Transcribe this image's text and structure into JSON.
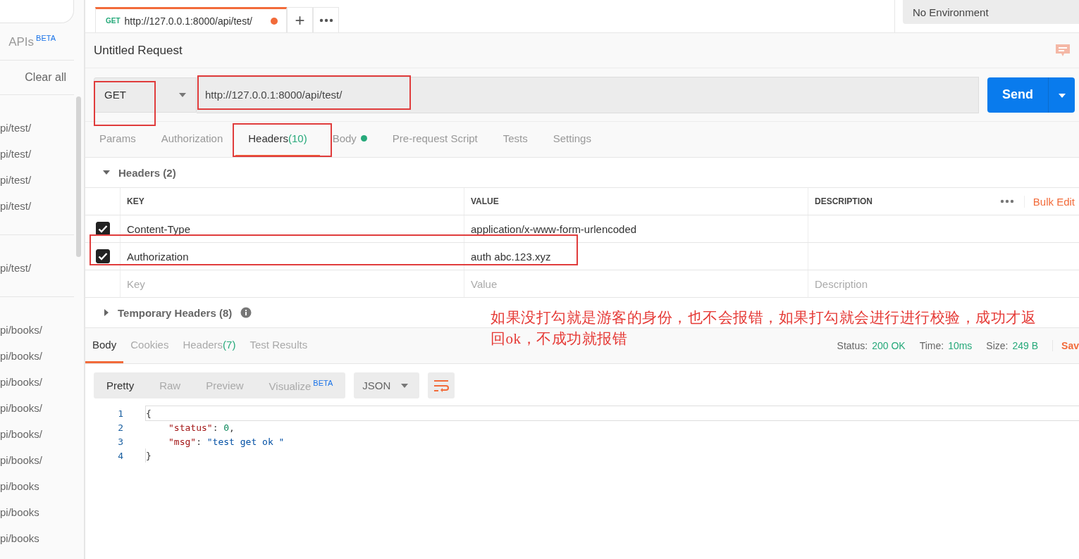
{
  "sidebar": {
    "apis_label": "APIs",
    "apis_badge": "BETA",
    "clear_all": "Clear all",
    "history_groups": [
      [
        "pi/test/",
        "pi/test/",
        "pi/test/",
        "pi/test/"
      ],
      [
        "pi/test/"
      ],
      [
        "pi/books/",
        "pi/books/",
        "pi/books/",
        "pi/books/",
        "pi/books/",
        "pi/books/",
        "pi/books",
        "pi/books",
        "pi/books"
      ]
    ]
  },
  "open_tab": {
    "method": "GET",
    "url": "http://127.0.0.1:8000/api/test/",
    "unsaved": true,
    "selected": true
  },
  "new_tab": "+",
  "environment": "No Environment",
  "request": {
    "title": "Untitled Request",
    "method": "GET",
    "url": "http://127.0.0.1:8000/api/test/",
    "send": "Send"
  },
  "request_tabs": [
    {
      "label": "Params",
      "selected": false
    },
    {
      "label": "Authorization",
      "selected": false
    },
    {
      "label": "Headers",
      "count": "(10)",
      "selected": true
    },
    {
      "label": "Body",
      "dot": true,
      "selected": false
    },
    {
      "label": "Pre-request Script",
      "selected": false
    },
    {
      "label": "Tests",
      "selected": false
    },
    {
      "label": "Settings",
      "selected": false
    }
  ],
  "headers_section": {
    "title": "Headers",
    "count": "(2)",
    "expanded": true
  },
  "columns": [
    "KEY",
    "VALUE",
    "DESCRIPTION"
  ],
  "bulk_edit": "Bulk Edit",
  "header_rows": [
    {
      "key": "Content-Type",
      "value": "application/x-www-form-urlencoded",
      "checked": true
    },
    {
      "key": "Authorization",
      "value": "auth abc.123.xyz",
      "checked": true
    }
  ],
  "new_row": {
    "key_placeholder": "Key",
    "value_placeholder": "Value",
    "description_placeholder": "Description"
  },
  "temporary_headers": {
    "title": "Temporary Headers",
    "count": "(8)",
    "expanded": false
  },
  "annotation_lines": [
    "如果没打勾就是游客的身份，也不会报错，如果打勾就会进行进行校验，成功才返",
    "回ok，不成功就报错"
  ],
  "response_tabs": [
    {
      "label": "Body",
      "selected": true
    },
    {
      "label": "Cookies",
      "selected": false
    },
    {
      "label": "Headers",
      "count": "(7)",
      "selected": false
    },
    {
      "label": "Test Results",
      "selected": false
    }
  ],
  "response_meta": [
    {
      "label": "Status:",
      "value": "200 OK"
    },
    {
      "label": "Time:",
      "value": "10ms"
    },
    {
      "label": "Size:",
      "value": "249 B"
    }
  ],
  "save": "Sav",
  "view_modes": [
    {
      "label": "Pretty",
      "selected": true
    },
    {
      "label": "Raw",
      "selected": false
    },
    {
      "label": "Preview",
      "selected": false
    },
    {
      "label": "Visualize",
      "badge": "BETA",
      "selected": false
    }
  ],
  "format": "JSON",
  "code_lines": [
    {
      "number": "1",
      "indent": false,
      "tokens": [
        {
          "kind": "punct",
          "text": "{"
        }
      ]
    },
    {
      "number": "2",
      "indent": true,
      "tokens": [
        {
          "kind": "key",
          "text": "\"status\""
        },
        {
          "kind": "punct",
          "text": ": "
        },
        {
          "kind": "number",
          "text": "0"
        },
        {
          "kind": "punct",
          "text": ","
        }
      ]
    },
    {
      "number": "3",
      "indent": true,
      "tokens": [
        {
          "kind": "key",
          "text": "\"msg\""
        },
        {
          "kind": "punct",
          "text": ": "
        },
        {
          "kind": "string",
          "text": "\"test get ok \""
        }
      ]
    },
    {
      "number": "4",
      "indent": false,
      "tokens": [
        {
          "kind": "punct",
          "text": "}"
        }
      ]
    }
  ]
}
